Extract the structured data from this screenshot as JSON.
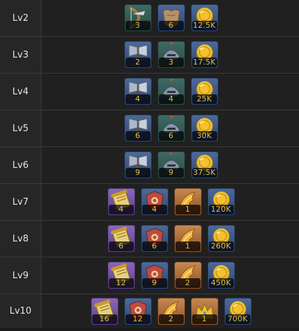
{
  "rows": [
    {
      "level": "Lv2",
      "items": [
        {
          "icon": "bow-icon",
          "rarity": "green",
          "count": "3"
        },
        {
          "icon": "fur-pelt-icon",
          "rarity": "blue",
          "count": "6"
        },
        {
          "icon": "gold-coin-icon",
          "rarity": "blue",
          "count": "12.5K"
        }
      ]
    },
    {
      "level": "Lv3",
      "items": [
        {
          "icon": "axe-icon",
          "rarity": "blue",
          "count": "2"
        },
        {
          "icon": "helmet-icon",
          "rarity": "green",
          "count": "3"
        },
        {
          "icon": "gold-coin-icon",
          "rarity": "blue",
          "count": "17.5K"
        }
      ]
    },
    {
      "level": "Lv4",
      "items": [
        {
          "icon": "axe-icon",
          "rarity": "blue",
          "count": "4"
        },
        {
          "icon": "helmet-icon",
          "rarity": "green",
          "count": "4"
        },
        {
          "icon": "gold-coin-icon",
          "rarity": "blue",
          "count": "25K"
        }
      ]
    },
    {
      "level": "Lv5",
      "items": [
        {
          "icon": "axe-icon",
          "rarity": "blue",
          "count": "6"
        },
        {
          "icon": "helmet-icon",
          "rarity": "green",
          "count": "6"
        },
        {
          "icon": "gold-coin-icon",
          "rarity": "blue",
          "count": "30K"
        }
      ]
    },
    {
      "level": "Lv6",
      "items": [
        {
          "icon": "axe-icon",
          "rarity": "blue",
          "count": "9"
        },
        {
          "icon": "helmet-icon",
          "rarity": "green",
          "count": "9"
        },
        {
          "icon": "gold-coin-icon",
          "rarity": "blue",
          "count": "37.5K"
        }
      ]
    },
    {
      "level": "Lv7",
      "items": [
        {
          "icon": "scroll-icon",
          "rarity": "purple",
          "count": "4"
        },
        {
          "icon": "shield-icon",
          "rarity": "blue",
          "count": "4"
        },
        {
          "icon": "golden-wing-icon",
          "rarity": "orange",
          "count": "1"
        },
        {
          "icon": "gold-coin-icon",
          "rarity": "blue",
          "count": "120K"
        }
      ]
    },
    {
      "level": "Lv8",
      "items": [
        {
          "icon": "scroll-icon",
          "rarity": "purple",
          "count": "6"
        },
        {
          "icon": "shield-icon",
          "rarity": "blue",
          "count": "6"
        },
        {
          "icon": "golden-wing-icon",
          "rarity": "orange",
          "count": "1"
        },
        {
          "icon": "gold-coin-icon",
          "rarity": "blue",
          "count": "260K"
        }
      ]
    },
    {
      "level": "Lv9",
      "items": [
        {
          "icon": "scroll-icon",
          "rarity": "purple",
          "count": "12"
        },
        {
          "icon": "shield-icon",
          "rarity": "blue",
          "count": "9"
        },
        {
          "icon": "golden-wing-icon",
          "rarity": "orange",
          "count": "2"
        },
        {
          "icon": "gold-coin-icon",
          "rarity": "blue",
          "count": "450K"
        }
      ]
    },
    {
      "level": "Lv10",
      "items": [
        {
          "icon": "scroll-icon",
          "rarity": "purple",
          "count": "16"
        },
        {
          "icon": "shield-icon",
          "rarity": "blue",
          "count": "12"
        },
        {
          "icon": "golden-wing-icon",
          "rarity": "orange",
          "count": "2"
        },
        {
          "icon": "crown-icon",
          "rarity": "orange",
          "count": "1"
        },
        {
          "icon": "gold-coin-icon",
          "rarity": "blue",
          "count": "700K"
        }
      ]
    }
  ],
  "colors": {
    "count_text": "#e0c14c",
    "level_text": "#e6e6e6",
    "row_bg": "#202020",
    "level_bg": "#262626",
    "divider": "#3a3a3a"
  }
}
